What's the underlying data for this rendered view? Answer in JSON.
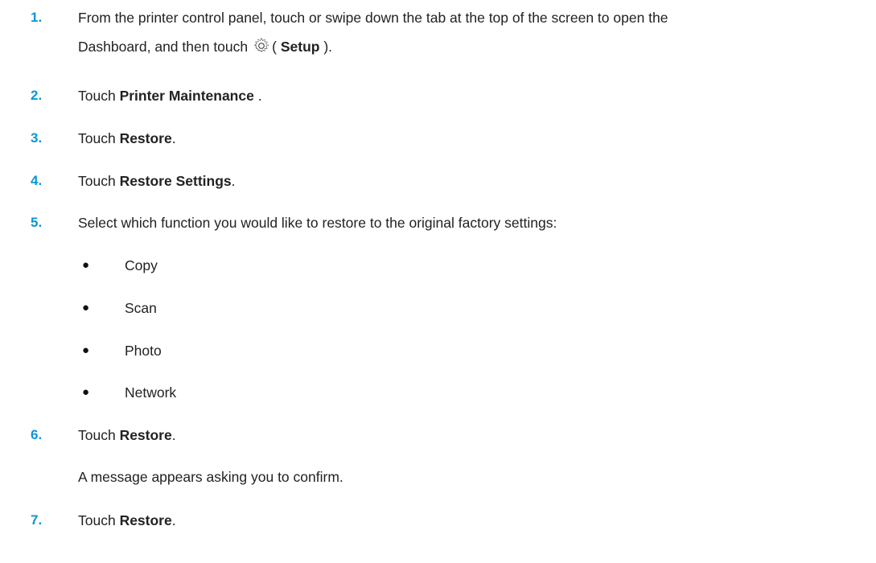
{
  "steps": [
    {
      "number": "1.",
      "line1": "From the printer control panel, touch or swipe down the tab at the top of the screen to open the",
      "line2_pre": "Dashboard, and then touch",
      "icon": "gear-icon",
      "line2_paren_open": "( ",
      "line2_bold": "Setup",
      "line2_post": " )."
    },
    {
      "number": "2.",
      "pre": "Touch ",
      "bold": "Printer Maintenance",
      "post": " ."
    },
    {
      "number": "3.",
      "pre": "Touch ",
      "bold": "Restore",
      "post": "."
    },
    {
      "number": "4.",
      "pre": "Touch ",
      "bold": "Restore Settings",
      "post": "."
    },
    {
      "number": "5.",
      "text": "Select which function you would like to restore to the original factory settings:"
    },
    {
      "number": "6.",
      "pre": "Touch ",
      "bold": "Restore",
      "post": "."
    },
    {
      "number": "7.",
      "pre": "Touch ",
      "bold": "Restore",
      "post": "."
    }
  ],
  "functions": [
    {
      "bullet": "●",
      "label": "Copy"
    },
    {
      "bullet": "●",
      "label": "Scan"
    },
    {
      "bullet": "●",
      "label": "Photo"
    },
    {
      "bullet": "●",
      "label": "Network"
    }
  ],
  "confirm_note": "A message appears asking you to confirm.",
  "colors": {
    "step_number": "#0a96d6",
    "text": "#222222"
  }
}
